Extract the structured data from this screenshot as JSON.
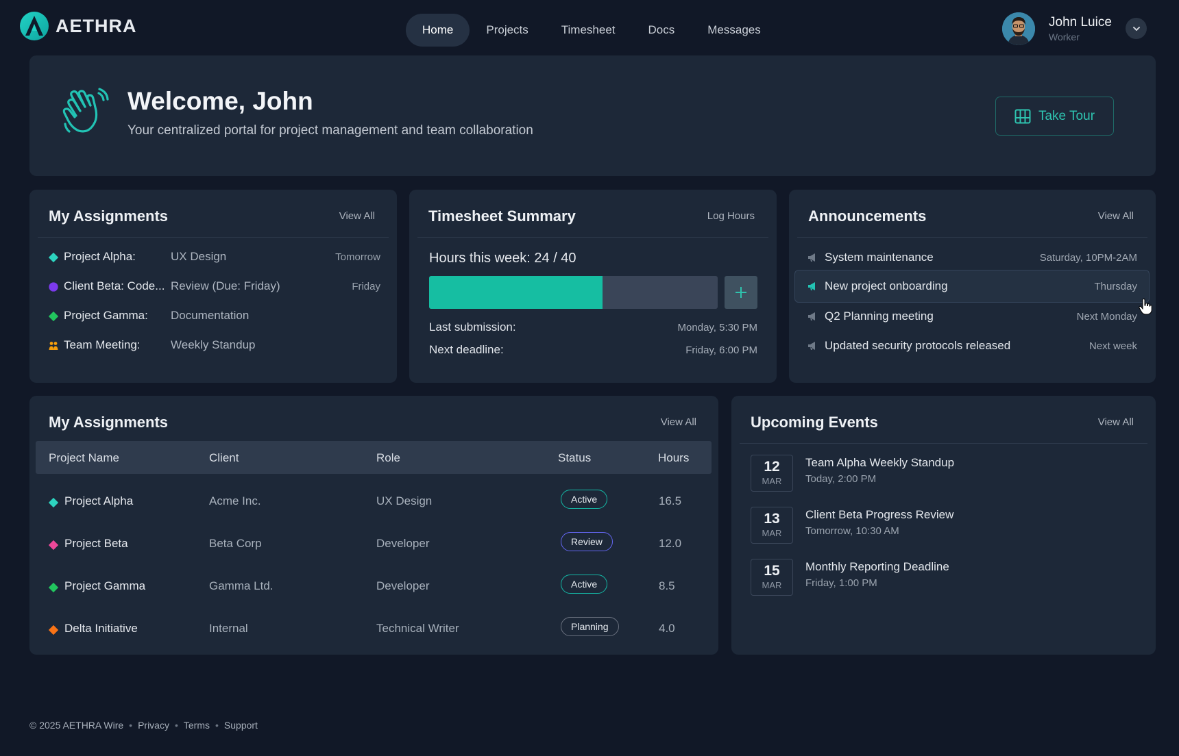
{
  "brand": {
    "name": "AETHRA"
  },
  "nav": {
    "items": [
      {
        "label": "Home",
        "active": true
      },
      {
        "label": "Projects"
      },
      {
        "label": "Timesheet"
      },
      {
        "label": "Docs"
      },
      {
        "label": "Messages"
      }
    ]
  },
  "user": {
    "name": "John Luice",
    "role": "Worker"
  },
  "welcome": {
    "title": "Welcome, John",
    "subtitle": "Your centralized portal for project management and team collaboration",
    "tour_label": "Take Tour"
  },
  "assignments_summary": {
    "title": "My Assignments",
    "link": "View All",
    "items": [
      {
        "name": "Project Alpha:",
        "value": "UX Design",
        "when": "Tomorrow",
        "icon": "teal-diamond",
        "color": "#2dd4bf"
      },
      {
        "name": "Client Beta: Code...",
        "value": "Review (Due: Friday)",
        "when": "Friday",
        "icon": "purple-circle",
        "color": "#7c3aed"
      },
      {
        "name": "Project Gamma:",
        "value": "Documentation",
        "when": "",
        "icon": "green-diamond",
        "color": "#22c55e"
      },
      {
        "name": "Team Meeting:",
        "value": "Weekly Standup",
        "when": "",
        "icon": "team-icon",
        "color": "#f59e0b"
      }
    ]
  },
  "timesheet": {
    "title": "Timesheet Summary",
    "link": "Log Hours",
    "hours_label": "Hours this week: 24 / 40",
    "hours_done": 24,
    "hours_target": 40,
    "last_submission_label": "Last submission:",
    "last_submission_value": "Monday, 5:30 PM",
    "next_deadline_label": "Next deadline:",
    "next_deadline_value": "Friday, 6:00 PM"
  },
  "announcements": {
    "title": "Announcements",
    "link": "View All",
    "items": [
      {
        "title": "System maintenance",
        "date": "Saturday, 10PM-2AM"
      },
      {
        "title": "New project onboarding",
        "date": "Thursday",
        "highlighted": true
      },
      {
        "title": "Q2 Planning meeting",
        "date": "Next Monday"
      },
      {
        "title": "Updated security protocols released",
        "date": "Next week"
      }
    ]
  },
  "assignments_table": {
    "title": "My Assignments",
    "link": "View All",
    "columns": [
      "Project Name",
      "Client",
      "Role",
      "Status",
      "Hours"
    ],
    "rows": [
      {
        "project": "Project Alpha",
        "client": "Acme Inc.",
        "role": "UX Design",
        "status": "Active",
        "hours": "16.5",
        "color": "#2dd4bf",
        "status_border": "#14b8a6"
      },
      {
        "project": "Project Beta",
        "client": "Beta Corp",
        "role": "Developer",
        "status": "Review",
        "hours": "12.0",
        "color": "#ec4899",
        "status_border": "#6366f1"
      },
      {
        "project": "Project Gamma",
        "client": "Gamma Ltd.",
        "role": "Developer",
        "status": "Active",
        "hours": "8.5",
        "color": "#22c55e",
        "status_border": "#14b8a6"
      },
      {
        "project": "Delta Initiative",
        "client": "Internal",
        "role": "Technical Writer",
        "status": "Planning",
        "hours": "4.0",
        "color": "#f97316",
        "status_border": "#6b7280"
      }
    ]
  },
  "events": {
    "title": "Upcoming Events",
    "link": "View All",
    "items": [
      {
        "day": "12",
        "month": "MAR",
        "title": "Team Alpha Weekly Standup",
        "time": "Today, 2:00 PM"
      },
      {
        "day": "13",
        "month": "MAR",
        "title": "Client Beta Progress Review",
        "time": "Tomorrow, 10:30 AM"
      },
      {
        "day": "15",
        "month": "MAR",
        "title": "Monthly Reporting Deadline",
        "time": "Friday, 1:00 PM"
      }
    ]
  },
  "footer": {
    "copyright": "© 2025 AETHRA Wire",
    "links": [
      "Privacy",
      "Terms",
      "Support"
    ]
  },
  "colors": {
    "accent": "#16bea2",
    "background": "#111827",
    "card": "#1d2838"
  }
}
